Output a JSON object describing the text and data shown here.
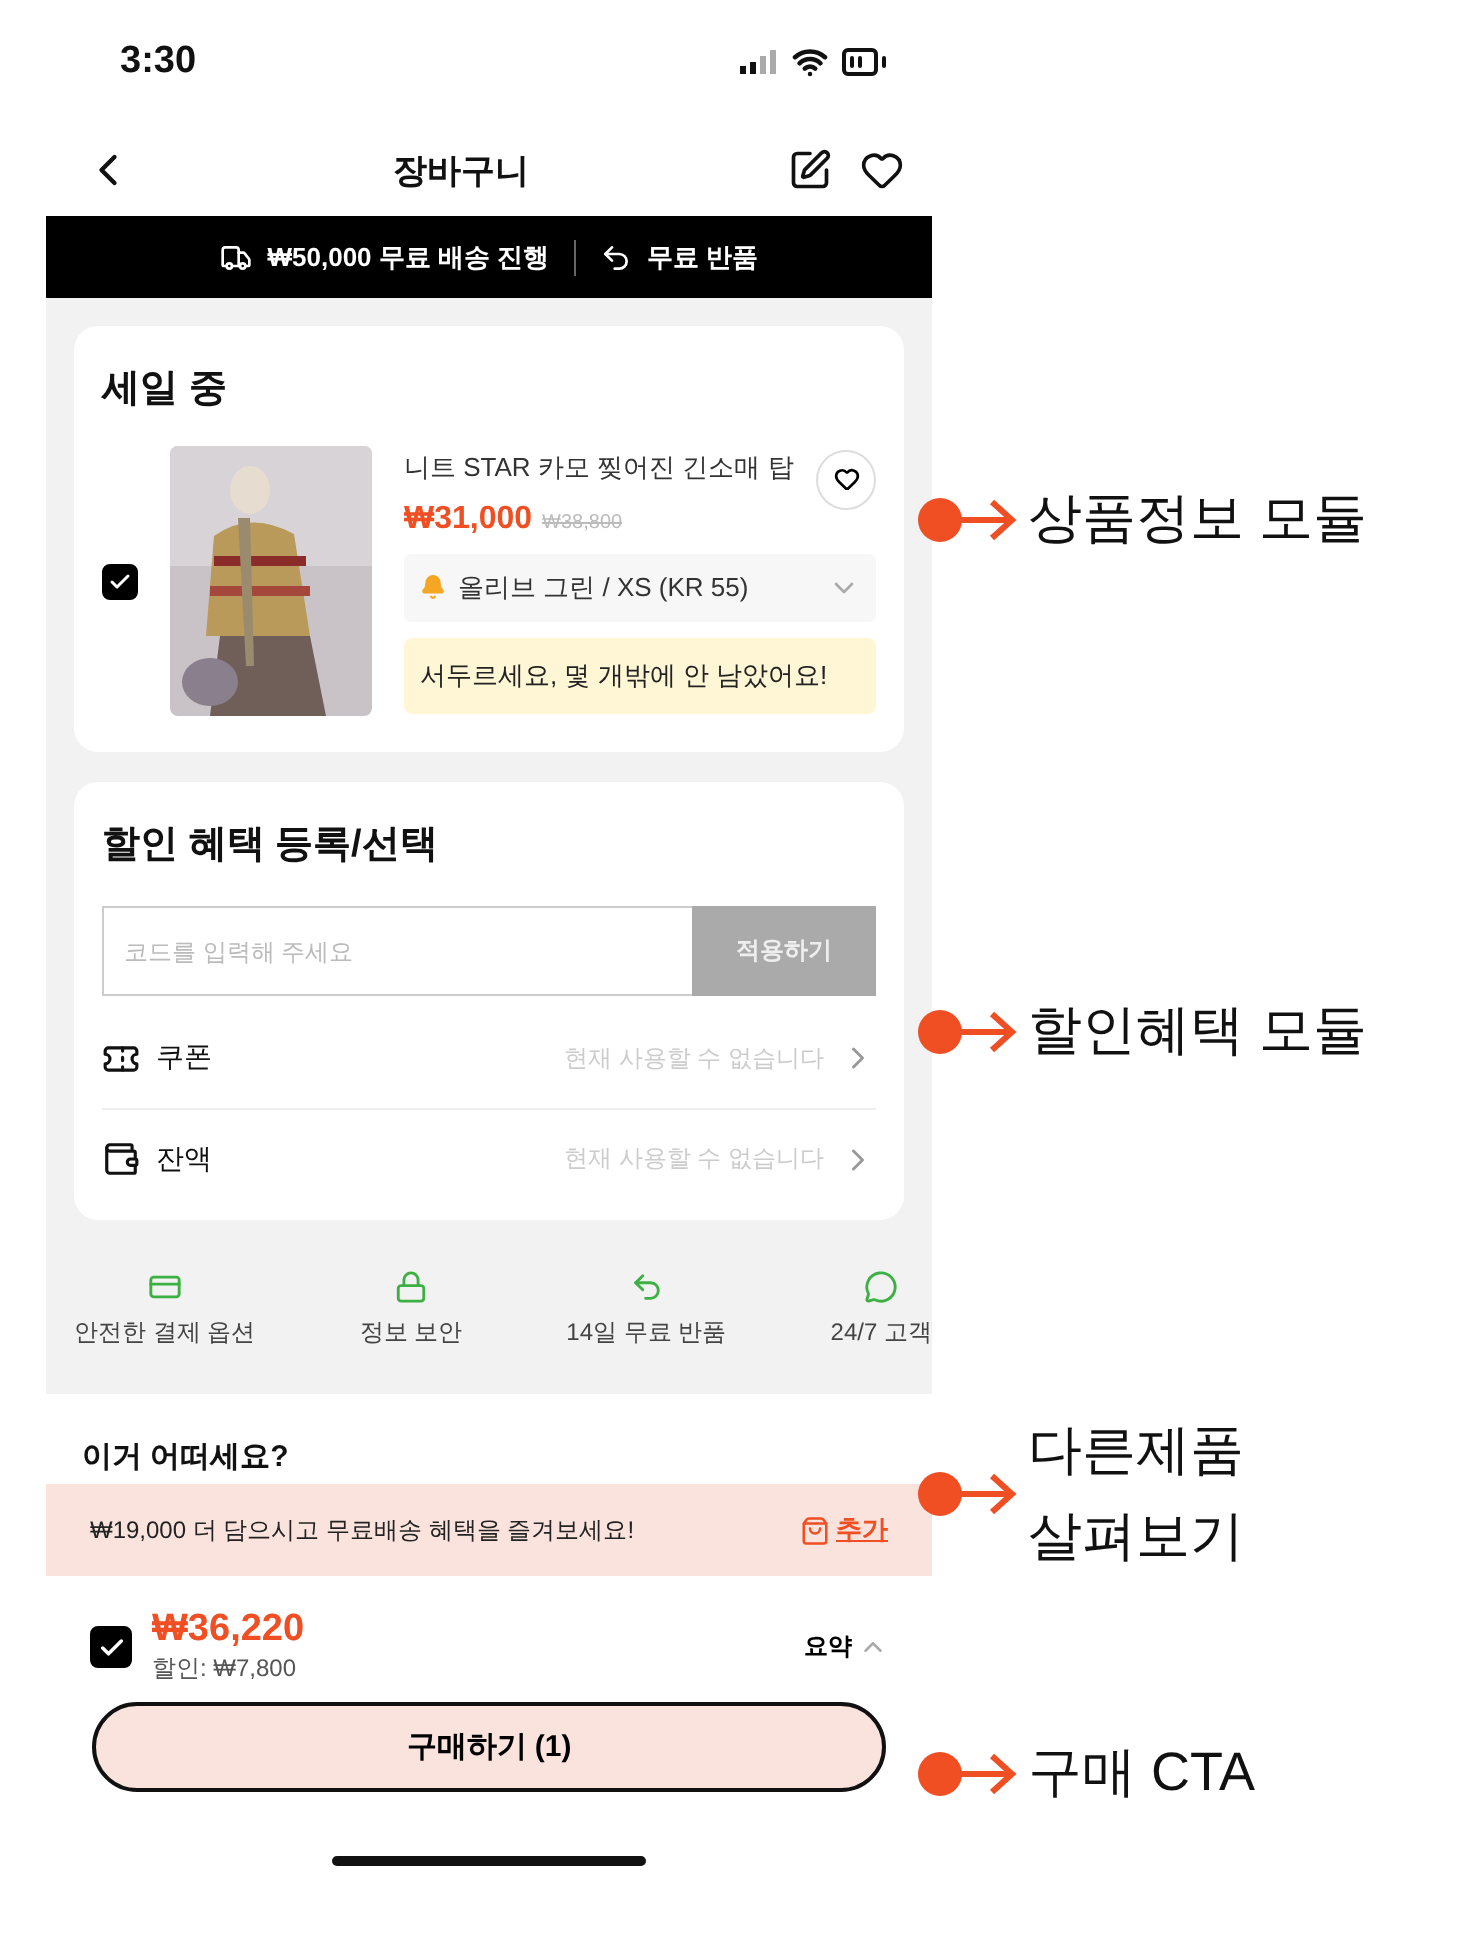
{
  "status_bar": {
    "time": "3:30"
  },
  "header": {
    "title": "장바구니"
  },
  "promo_bar": [
    {
      "kind": "shipping",
      "text": "₩50,000 무료 배송 진행"
    },
    {
      "kind": "return",
      "text": "무료 반품"
    }
  ],
  "sale_section": {
    "title": "세일 중",
    "item": {
      "checked": true,
      "name": "니트 STAR 카모 찢어진 긴소매 탑",
      "price": "₩31,000",
      "original_price": "₩38,800",
      "option": "올리브 그린 / XS (KR 55)",
      "notice": "서두르세요, 몇 개밖에 안 남았어요!"
    }
  },
  "discount_section": {
    "title": "할인 혜택 등록/선택",
    "code_field": {
      "placeholder": "코드를 입력해 주세요"
    },
    "apply_button": {
      "label": "적용하기",
      "disabled": true
    },
    "rows": [
      {
        "kind": "coupon",
        "label": "쿠폰",
        "status": "현재 사용할 수 없습니다"
      },
      {
        "kind": "balance",
        "label": "잔액",
        "status": "현재 사용할 수 없습니다"
      }
    ]
  },
  "trust_badges": [
    {
      "kind": "card",
      "label": "안전한 결제 옵션"
    },
    {
      "kind": "lock",
      "label": "정보 보안"
    },
    {
      "kind": "return",
      "label": "14일 무료 반품"
    },
    {
      "kind": "chat",
      "label": "24/7 고객"
    }
  ],
  "recommendations": {
    "title": "이거 어떠세요?"
  },
  "free_shipping_banner": {
    "text": "₩19,000 더 담으시고 무료배송 혜택을 즐겨보세요!",
    "action": "추가"
  },
  "summary": {
    "checked": true,
    "total": "₩36,220",
    "discount": "할인: ₩7,800",
    "toggle": "요약"
  },
  "cta": {
    "label": "구매하기 (1)"
  },
  "annotations": [
    {
      "label": "상품정보 모듈"
    },
    {
      "label": "할인혜택 모듈"
    },
    {
      "label": "다른제품 살펴보기"
    },
    {
      "label": "구매 CTA"
    }
  ]
}
